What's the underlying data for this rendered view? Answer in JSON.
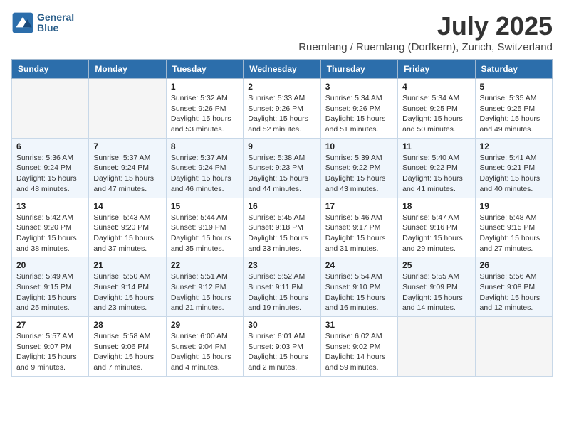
{
  "header": {
    "logo_line1": "General",
    "logo_line2": "Blue",
    "title": "July 2025",
    "subtitle": "Ruemlang / Ruemlang (Dorfkern), Zurich, Switzerland"
  },
  "weekdays": [
    "Sunday",
    "Monday",
    "Tuesday",
    "Wednesday",
    "Thursday",
    "Friday",
    "Saturday"
  ],
  "weeks": [
    [
      {
        "day": "",
        "info": ""
      },
      {
        "day": "",
        "info": ""
      },
      {
        "day": "1",
        "info": "Sunrise: 5:32 AM\nSunset: 9:26 PM\nDaylight: 15 hours\nand 53 minutes."
      },
      {
        "day": "2",
        "info": "Sunrise: 5:33 AM\nSunset: 9:26 PM\nDaylight: 15 hours\nand 52 minutes."
      },
      {
        "day": "3",
        "info": "Sunrise: 5:34 AM\nSunset: 9:26 PM\nDaylight: 15 hours\nand 51 minutes."
      },
      {
        "day": "4",
        "info": "Sunrise: 5:34 AM\nSunset: 9:25 PM\nDaylight: 15 hours\nand 50 minutes."
      },
      {
        "day": "5",
        "info": "Sunrise: 5:35 AM\nSunset: 9:25 PM\nDaylight: 15 hours\nand 49 minutes."
      }
    ],
    [
      {
        "day": "6",
        "info": "Sunrise: 5:36 AM\nSunset: 9:24 PM\nDaylight: 15 hours\nand 48 minutes."
      },
      {
        "day": "7",
        "info": "Sunrise: 5:37 AM\nSunset: 9:24 PM\nDaylight: 15 hours\nand 47 minutes."
      },
      {
        "day": "8",
        "info": "Sunrise: 5:37 AM\nSunset: 9:24 PM\nDaylight: 15 hours\nand 46 minutes."
      },
      {
        "day": "9",
        "info": "Sunrise: 5:38 AM\nSunset: 9:23 PM\nDaylight: 15 hours\nand 44 minutes."
      },
      {
        "day": "10",
        "info": "Sunrise: 5:39 AM\nSunset: 9:22 PM\nDaylight: 15 hours\nand 43 minutes."
      },
      {
        "day": "11",
        "info": "Sunrise: 5:40 AM\nSunset: 9:22 PM\nDaylight: 15 hours\nand 41 minutes."
      },
      {
        "day": "12",
        "info": "Sunrise: 5:41 AM\nSunset: 9:21 PM\nDaylight: 15 hours\nand 40 minutes."
      }
    ],
    [
      {
        "day": "13",
        "info": "Sunrise: 5:42 AM\nSunset: 9:20 PM\nDaylight: 15 hours\nand 38 minutes."
      },
      {
        "day": "14",
        "info": "Sunrise: 5:43 AM\nSunset: 9:20 PM\nDaylight: 15 hours\nand 37 minutes."
      },
      {
        "day": "15",
        "info": "Sunrise: 5:44 AM\nSunset: 9:19 PM\nDaylight: 15 hours\nand 35 minutes."
      },
      {
        "day": "16",
        "info": "Sunrise: 5:45 AM\nSunset: 9:18 PM\nDaylight: 15 hours\nand 33 minutes."
      },
      {
        "day": "17",
        "info": "Sunrise: 5:46 AM\nSunset: 9:17 PM\nDaylight: 15 hours\nand 31 minutes."
      },
      {
        "day": "18",
        "info": "Sunrise: 5:47 AM\nSunset: 9:16 PM\nDaylight: 15 hours\nand 29 minutes."
      },
      {
        "day": "19",
        "info": "Sunrise: 5:48 AM\nSunset: 9:15 PM\nDaylight: 15 hours\nand 27 minutes."
      }
    ],
    [
      {
        "day": "20",
        "info": "Sunrise: 5:49 AM\nSunset: 9:15 PM\nDaylight: 15 hours\nand 25 minutes."
      },
      {
        "day": "21",
        "info": "Sunrise: 5:50 AM\nSunset: 9:14 PM\nDaylight: 15 hours\nand 23 minutes."
      },
      {
        "day": "22",
        "info": "Sunrise: 5:51 AM\nSunset: 9:12 PM\nDaylight: 15 hours\nand 21 minutes."
      },
      {
        "day": "23",
        "info": "Sunrise: 5:52 AM\nSunset: 9:11 PM\nDaylight: 15 hours\nand 19 minutes."
      },
      {
        "day": "24",
        "info": "Sunrise: 5:54 AM\nSunset: 9:10 PM\nDaylight: 15 hours\nand 16 minutes."
      },
      {
        "day": "25",
        "info": "Sunrise: 5:55 AM\nSunset: 9:09 PM\nDaylight: 15 hours\nand 14 minutes."
      },
      {
        "day": "26",
        "info": "Sunrise: 5:56 AM\nSunset: 9:08 PM\nDaylight: 15 hours\nand 12 minutes."
      }
    ],
    [
      {
        "day": "27",
        "info": "Sunrise: 5:57 AM\nSunset: 9:07 PM\nDaylight: 15 hours\nand 9 minutes."
      },
      {
        "day": "28",
        "info": "Sunrise: 5:58 AM\nSunset: 9:06 PM\nDaylight: 15 hours\nand 7 minutes."
      },
      {
        "day": "29",
        "info": "Sunrise: 6:00 AM\nSunset: 9:04 PM\nDaylight: 15 hours\nand 4 minutes."
      },
      {
        "day": "30",
        "info": "Sunrise: 6:01 AM\nSunset: 9:03 PM\nDaylight: 15 hours\nand 2 minutes."
      },
      {
        "day": "31",
        "info": "Sunrise: 6:02 AM\nSunset: 9:02 PM\nDaylight: 14 hours\nand 59 minutes."
      },
      {
        "day": "",
        "info": ""
      },
      {
        "day": "",
        "info": ""
      }
    ]
  ]
}
